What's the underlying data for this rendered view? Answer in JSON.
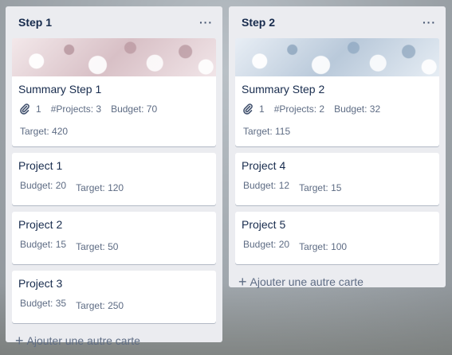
{
  "lists": [
    {
      "title": "Step 1",
      "menu_label": "···",
      "summary": {
        "title": "Summary Step 1",
        "attachments": "1",
        "projects": "#Projects: 3",
        "budget": "Budget: 70",
        "target": "Target: 420"
      },
      "cards": [
        {
          "title": "Project 1",
          "budget": "Budget: 20",
          "target": "Target: 120"
        },
        {
          "title": "Project 2",
          "budget": "Budget: 15",
          "target": "Target: 50"
        },
        {
          "title": "Project 3",
          "budget": "Budget: 35",
          "target": "Target: 250"
        }
      ],
      "add_label": "Ajouter une autre carte"
    },
    {
      "title": "Step 2",
      "menu_label": "···",
      "summary": {
        "title": "Summary Step 2",
        "attachments": "1",
        "projects": "#Projects: 2",
        "budget": "Budget: 32",
        "target": "Target: 115"
      },
      "cards": [
        {
          "title": "Project 4",
          "budget": "Budget: 12",
          "target": "Target: 15"
        },
        {
          "title": "Project 5",
          "budget": "Budget: 20",
          "target": "Target: 100"
        }
      ],
      "add_label": "Ajouter une autre carte"
    }
  ],
  "icons": {
    "attachment": "paperclip-icon",
    "add": "plus-icon",
    "menu": "ellipsis-icon"
  },
  "colors": {
    "list_bg": "#ebecf0",
    "card_bg": "#ffffff",
    "title_text": "#172b4d",
    "meta_text": "#5e6c84"
  }
}
